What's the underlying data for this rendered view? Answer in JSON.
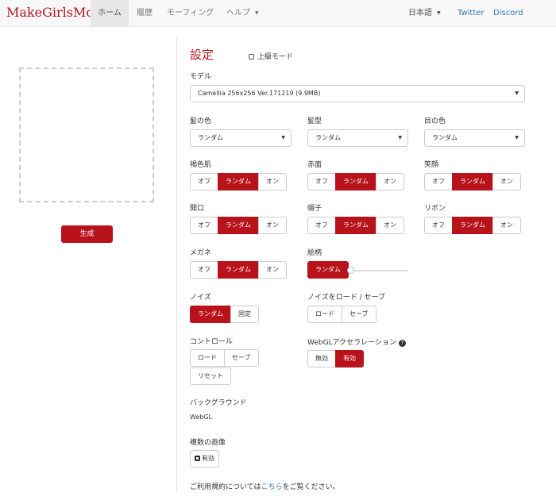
{
  "nav": {
    "brand": "MakeGirlsMoe",
    "home": "ホーム",
    "history": "履歴",
    "morphing": "モーフィング",
    "help": "ヘルプ",
    "language": "日本語",
    "twitter": "Twitter",
    "discord": "Discord"
  },
  "generate_label": "生成",
  "settings": {
    "title": "設定",
    "advanced_mode": "上級モード",
    "model_label": "モデル",
    "model_value": "Camellia 256x256 Ver.171219 (9.9MB)",
    "hair_color": {
      "label": "髪の色",
      "value": "ランダム"
    },
    "hair_style": {
      "label": "髪型",
      "value": "ランダム"
    },
    "eye_color": {
      "label": "目の色",
      "value": "ランダム"
    },
    "toggle_options": {
      "off": "オフ",
      "random": "ランダム",
      "on": "オン"
    },
    "dark_skin": "褐色肌",
    "blush": "赤面",
    "smile": "笑顔",
    "open_mouth": "開口",
    "hat": "帽子",
    "ribbon": "リボン",
    "glasses": "メガネ",
    "art_style": {
      "label": "絵柄",
      "button": "ランダム",
      "slider_level": 0
    },
    "noise": {
      "label": "ノイズ",
      "random": "ランダム",
      "fixed": "固定"
    },
    "noise_load_save": {
      "label": "ノイズをロード / セーブ",
      "load": "ロード",
      "save": "セーブ"
    },
    "control": {
      "label": "コントロール",
      "load": "ロード",
      "save": "セーブ",
      "reset": "リセット"
    },
    "webgl": {
      "label": "WebGLアクセラレーション",
      "disabled": "無効",
      "enabled": "有効"
    },
    "background": {
      "label": "バックグラウンド",
      "value": "WebGL"
    },
    "multiple": {
      "label": "複数の画像",
      "button": "有効"
    },
    "terms": {
      "prefix": "ご利用規約については",
      "link": "こちら",
      "suffix": "をご覧ください。"
    }
  },
  "colors": {
    "accent": "#b8121b",
    "link": "#337ab7"
  }
}
